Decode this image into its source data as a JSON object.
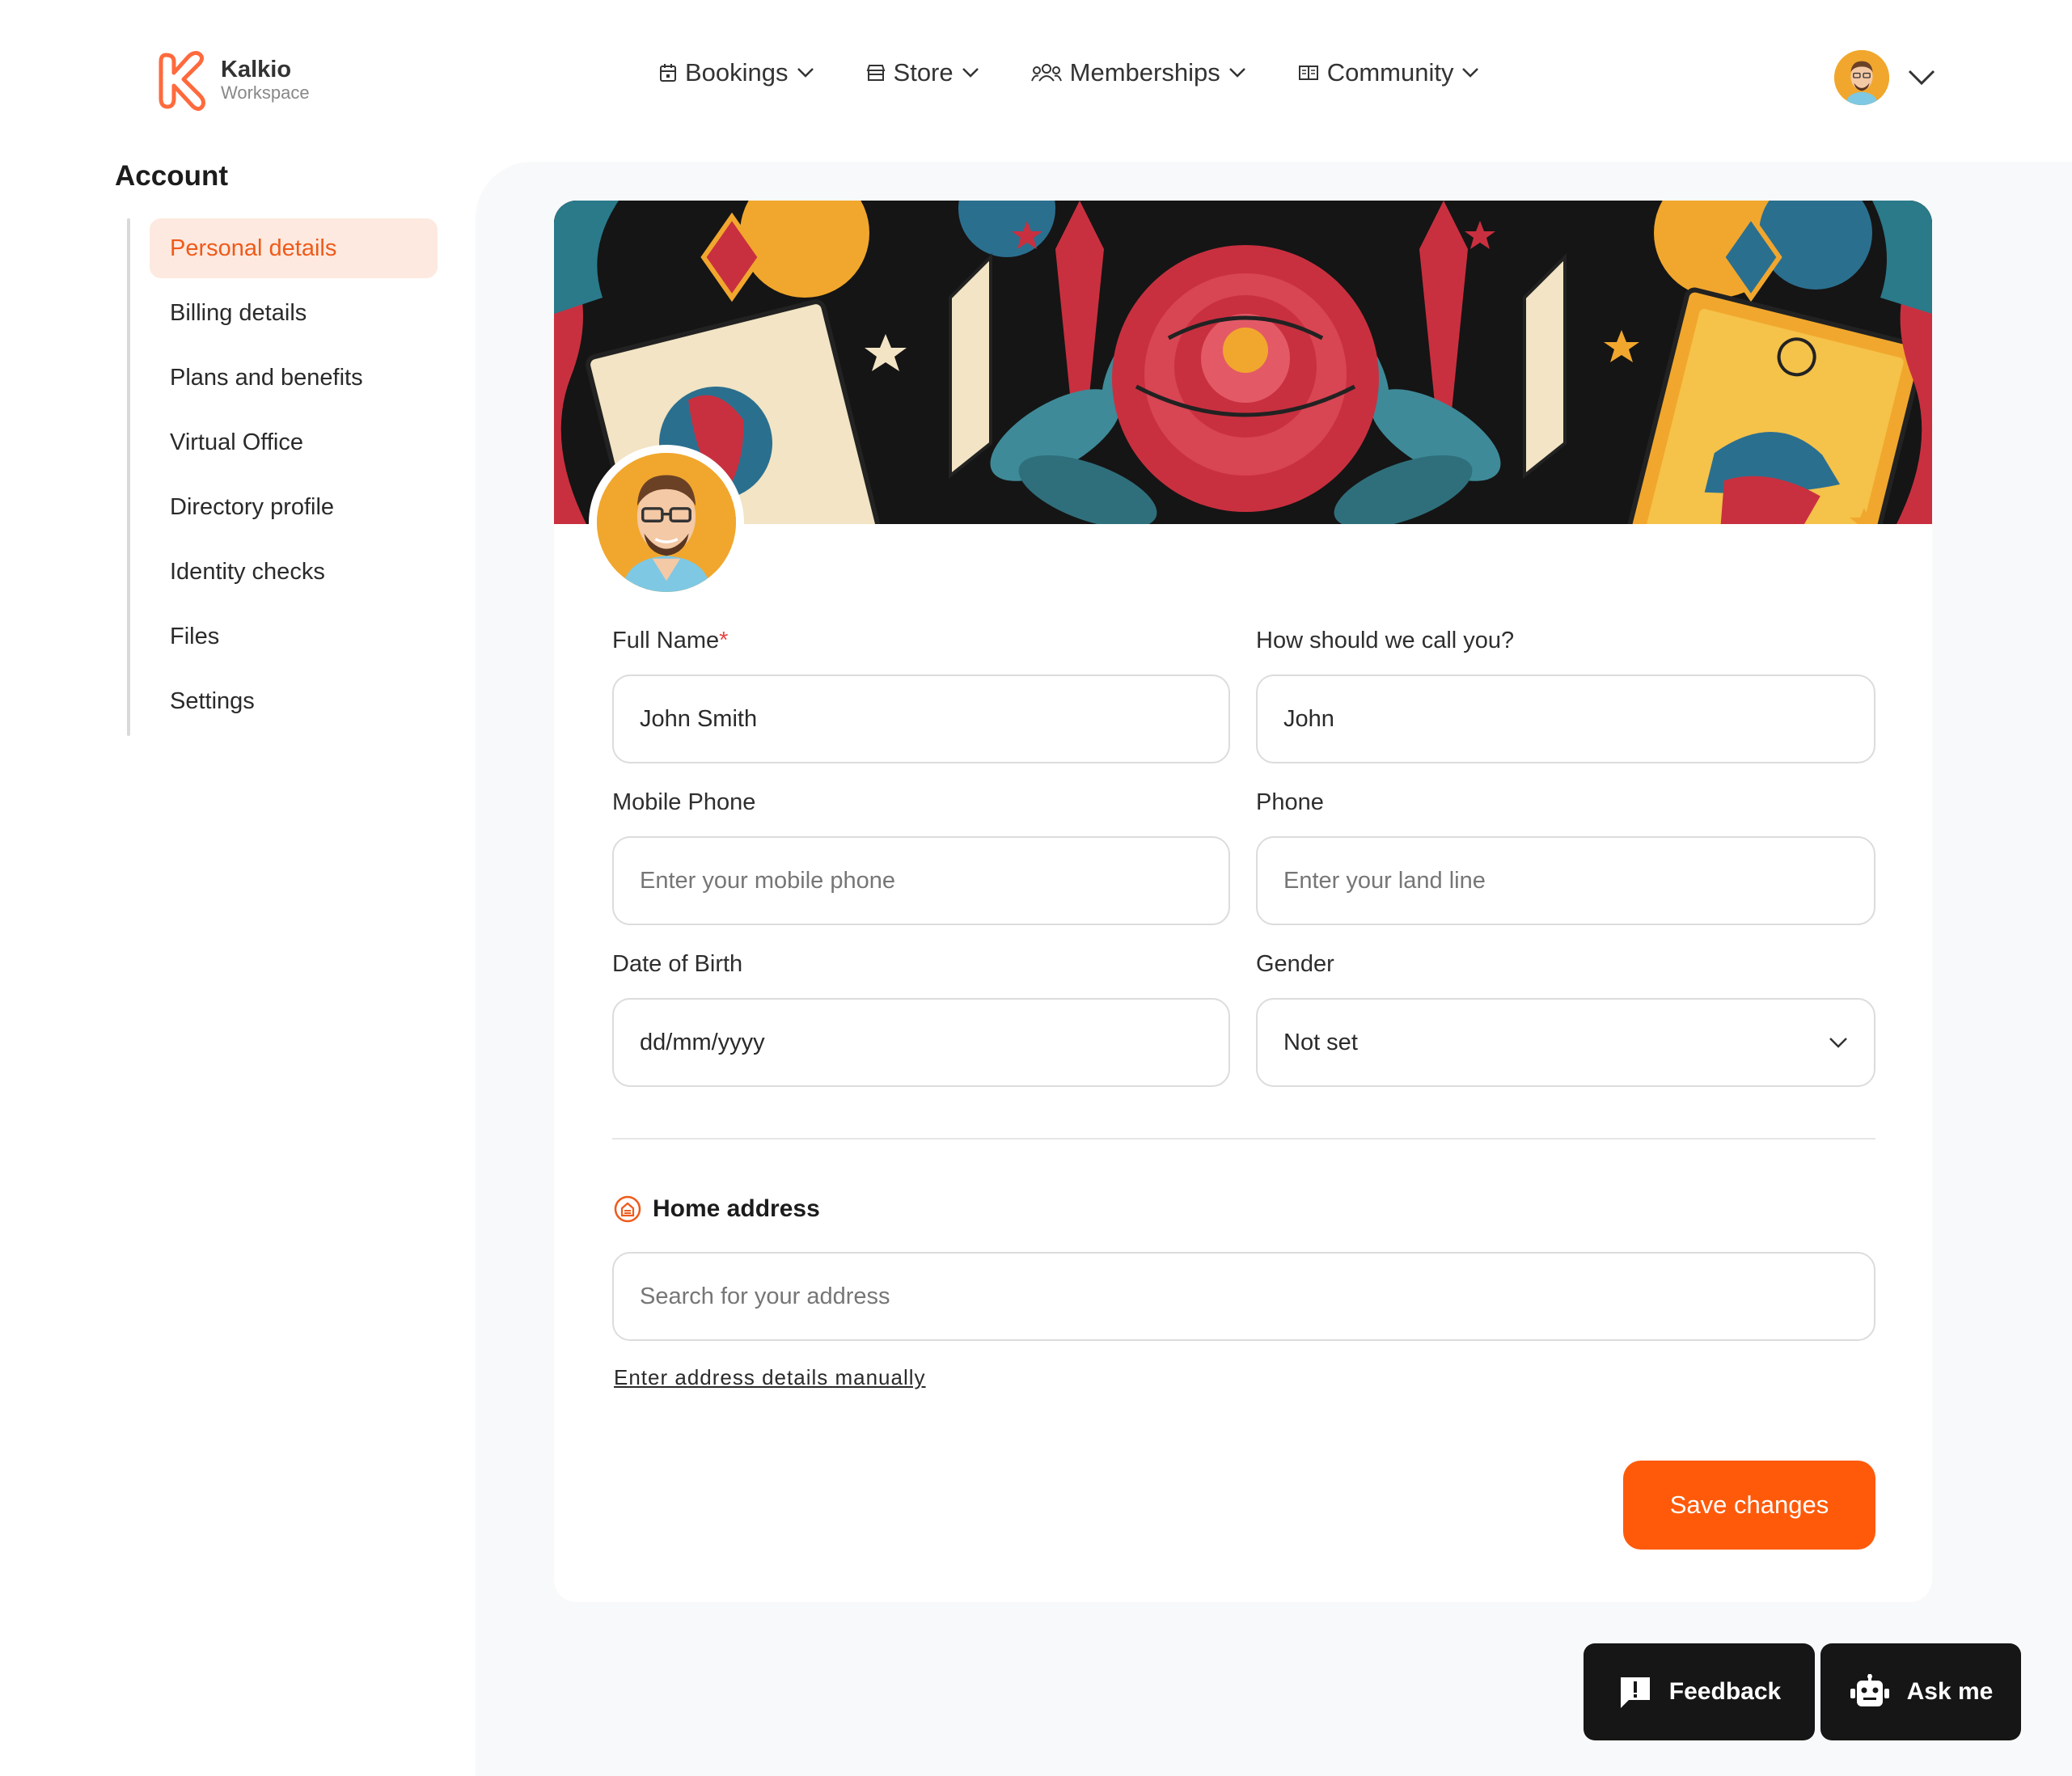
{
  "app": {
    "brand": "Kalkio",
    "subtitle": "Workspace",
    "accent_color": "#ff5a0a"
  },
  "nav": [
    {
      "label": "Bookings",
      "icon": "calendar-icon"
    },
    {
      "label": "Store",
      "icon": "store-icon"
    },
    {
      "label": "Memberships",
      "icon": "users-icon"
    },
    {
      "label": "Community",
      "icon": "book-icon"
    }
  ],
  "sidebar": {
    "title": "Account",
    "items": [
      {
        "label": "Personal details",
        "active": true
      },
      {
        "label": "Billing details"
      },
      {
        "label": "Plans and benefits"
      },
      {
        "label": "Virtual Office"
      },
      {
        "label": "Directory profile"
      },
      {
        "label": "Identity checks"
      },
      {
        "label": "Files"
      },
      {
        "label": "Settings"
      }
    ]
  },
  "form": {
    "full_name": {
      "label": "Full Name",
      "required_mark": "*",
      "value": "John Smith"
    },
    "nickname": {
      "label": "How should we call you?",
      "value": "John"
    },
    "mobile_phone": {
      "label": "Mobile Phone",
      "placeholder": "Enter your mobile phone"
    },
    "phone": {
      "label": "Phone",
      "placeholder": "Enter your land line"
    },
    "dob": {
      "label": "Date of Birth",
      "placeholder": "dd/mm/yyyy"
    },
    "gender": {
      "label": "Gender",
      "value": "Not set"
    }
  },
  "address": {
    "title": "Home address",
    "placeholder": "Search for your address",
    "manual_link": "Enter address details manually"
  },
  "save_label": "Save changes",
  "floating": {
    "feedback": "Feedback",
    "ask_me": "Ask me"
  }
}
